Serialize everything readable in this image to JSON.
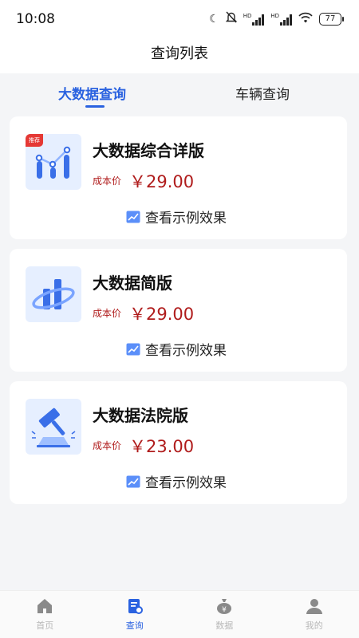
{
  "status_bar": {
    "time": "10:08",
    "battery": "77",
    "hd1": "HD",
    "hd2": "HD"
  },
  "header": {
    "title": "查询列表"
  },
  "tabs": [
    {
      "label": "大数据查询",
      "active": true
    },
    {
      "label": "车辆查询",
      "active": false
    }
  ],
  "cards": [
    {
      "name": "大数据综合详版",
      "badge": "推荐",
      "price_label": "成本价",
      "price": "￥29.00",
      "link": "查看示例效果"
    },
    {
      "name": "大数据简版",
      "price_label": "成本价",
      "price": "￥29.00",
      "link": "查看示例效果"
    },
    {
      "name": "大数据法院版",
      "price_label": "成本价",
      "price": "￥23.00",
      "link": "查看示例效果"
    }
  ],
  "bottom_nav": [
    {
      "label": "首页",
      "icon": "home-icon"
    },
    {
      "label": "查询",
      "icon": "query-icon",
      "active": true
    },
    {
      "label": "数据",
      "icon": "money-bag-icon"
    },
    {
      "label": "我的",
      "icon": "user-icon"
    }
  ],
  "colors": {
    "accent": "#2a62e0",
    "price": "#b01c1c",
    "badge": "#e53935"
  }
}
